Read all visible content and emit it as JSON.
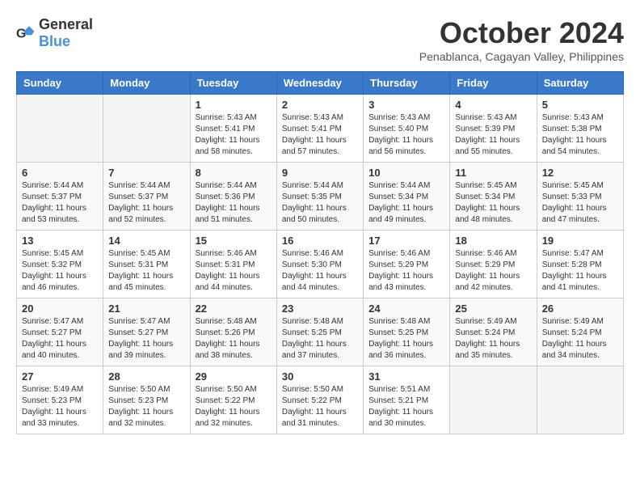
{
  "logo": {
    "general": "General",
    "blue": "Blue"
  },
  "title": "October 2024",
  "location": "Penablanca, Cagayan Valley, Philippines",
  "headers": [
    "Sunday",
    "Monday",
    "Tuesday",
    "Wednesday",
    "Thursday",
    "Friday",
    "Saturday"
  ],
  "weeks": [
    [
      {
        "day": "",
        "sunrise": "",
        "sunset": "",
        "daylight": ""
      },
      {
        "day": "",
        "sunrise": "",
        "sunset": "",
        "daylight": ""
      },
      {
        "day": "1",
        "sunrise": "Sunrise: 5:43 AM",
        "sunset": "Sunset: 5:41 PM",
        "daylight": "Daylight: 11 hours and 58 minutes."
      },
      {
        "day": "2",
        "sunrise": "Sunrise: 5:43 AM",
        "sunset": "Sunset: 5:41 PM",
        "daylight": "Daylight: 11 hours and 57 minutes."
      },
      {
        "day": "3",
        "sunrise": "Sunrise: 5:43 AM",
        "sunset": "Sunset: 5:40 PM",
        "daylight": "Daylight: 11 hours and 56 minutes."
      },
      {
        "day": "4",
        "sunrise": "Sunrise: 5:43 AM",
        "sunset": "Sunset: 5:39 PM",
        "daylight": "Daylight: 11 hours and 55 minutes."
      },
      {
        "day": "5",
        "sunrise": "Sunrise: 5:43 AM",
        "sunset": "Sunset: 5:38 PM",
        "daylight": "Daylight: 11 hours and 54 minutes."
      }
    ],
    [
      {
        "day": "6",
        "sunrise": "Sunrise: 5:44 AM",
        "sunset": "Sunset: 5:37 PM",
        "daylight": "Daylight: 11 hours and 53 minutes."
      },
      {
        "day": "7",
        "sunrise": "Sunrise: 5:44 AM",
        "sunset": "Sunset: 5:37 PM",
        "daylight": "Daylight: 11 hours and 52 minutes."
      },
      {
        "day": "8",
        "sunrise": "Sunrise: 5:44 AM",
        "sunset": "Sunset: 5:36 PM",
        "daylight": "Daylight: 11 hours and 51 minutes."
      },
      {
        "day": "9",
        "sunrise": "Sunrise: 5:44 AM",
        "sunset": "Sunset: 5:35 PM",
        "daylight": "Daylight: 11 hours and 50 minutes."
      },
      {
        "day": "10",
        "sunrise": "Sunrise: 5:44 AM",
        "sunset": "Sunset: 5:34 PM",
        "daylight": "Daylight: 11 hours and 49 minutes."
      },
      {
        "day": "11",
        "sunrise": "Sunrise: 5:45 AM",
        "sunset": "Sunset: 5:34 PM",
        "daylight": "Daylight: 11 hours and 48 minutes."
      },
      {
        "day": "12",
        "sunrise": "Sunrise: 5:45 AM",
        "sunset": "Sunset: 5:33 PM",
        "daylight": "Daylight: 11 hours and 47 minutes."
      }
    ],
    [
      {
        "day": "13",
        "sunrise": "Sunrise: 5:45 AM",
        "sunset": "Sunset: 5:32 PM",
        "daylight": "Daylight: 11 hours and 46 minutes."
      },
      {
        "day": "14",
        "sunrise": "Sunrise: 5:45 AM",
        "sunset": "Sunset: 5:31 PM",
        "daylight": "Daylight: 11 hours and 45 minutes."
      },
      {
        "day": "15",
        "sunrise": "Sunrise: 5:46 AM",
        "sunset": "Sunset: 5:31 PM",
        "daylight": "Daylight: 11 hours and 44 minutes."
      },
      {
        "day": "16",
        "sunrise": "Sunrise: 5:46 AM",
        "sunset": "Sunset: 5:30 PM",
        "daylight": "Daylight: 11 hours and 44 minutes."
      },
      {
        "day": "17",
        "sunrise": "Sunrise: 5:46 AM",
        "sunset": "Sunset: 5:29 PM",
        "daylight": "Daylight: 11 hours and 43 minutes."
      },
      {
        "day": "18",
        "sunrise": "Sunrise: 5:46 AM",
        "sunset": "Sunset: 5:29 PM",
        "daylight": "Daylight: 11 hours and 42 minutes."
      },
      {
        "day": "19",
        "sunrise": "Sunrise: 5:47 AM",
        "sunset": "Sunset: 5:28 PM",
        "daylight": "Daylight: 11 hours and 41 minutes."
      }
    ],
    [
      {
        "day": "20",
        "sunrise": "Sunrise: 5:47 AM",
        "sunset": "Sunset: 5:27 PM",
        "daylight": "Daylight: 11 hours and 40 minutes."
      },
      {
        "day": "21",
        "sunrise": "Sunrise: 5:47 AM",
        "sunset": "Sunset: 5:27 PM",
        "daylight": "Daylight: 11 hours and 39 minutes."
      },
      {
        "day": "22",
        "sunrise": "Sunrise: 5:48 AM",
        "sunset": "Sunset: 5:26 PM",
        "daylight": "Daylight: 11 hours and 38 minutes."
      },
      {
        "day": "23",
        "sunrise": "Sunrise: 5:48 AM",
        "sunset": "Sunset: 5:25 PM",
        "daylight": "Daylight: 11 hours and 37 minutes."
      },
      {
        "day": "24",
        "sunrise": "Sunrise: 5:48 AM",
        "sunset": "Sunset: 5:25 PM",
        "daylight": "Daylight: 11 hours and 36 minutes."
      },
      {
        "day": "25",
        "sunrise": "Sunrise: 5:49 AM",
        "sunset": "Sunset: 5:24 PM",
        "daylight": "Daylight: 11 hours and 35 minutes."
      },
      {
        "day": "26",
        "sunrise": "Sunrise: 5:49 AM",
        "sunset": "Sunset: 5:24 PM",
        "daylight": "Daylight: 11 hours and 34 minutes."
      }
    ],
    [
      {
        "day": "27",
        "sunrise": "Sunrise: 5:49 AM",
        "sunset": "Sunset: 5:23 PM",
        "daylight": "Daylight: 11 hours and 33 minutes."
      },
      {
        "day": "28",
        "sunrise": "Sunrise: 5:50 AM",
        "sunset": "Sunset: 5:23 PM",
        "daylight": "Daylight: 11 hours and 32 minutes."
      },
      {
        "day": "29",
        "sunrise": "Sunrise: 5:50 AM",
        "sunset": "Sunset: 5:22 PM",
        "daylight": "Daylight: 11 hours and 32 minutes."
      },
      {
        "day": "30",
        "sunrise": "Sunrise: 5:50 AM",
        "sunset": "Sunset: 5:22 PM",
        "daylight": "Daylight: 11 hours and 31 minutes."
      },
      {
        "day": "31",
        "sunrise": "Sunrise: 5:51 AM",
        "sunset": "Sunset: 5:21 PM",
        "daylight": "Daylight: 11 hours and 30 minutes."
      },
      {
        "day": "",
        "sunrise": "",
        "sunset": "",
        "daylight": ""
      },
      {
        "day": "",
        "sunrise": "",
        "sunset": "",
        "daylight": ""
      }
    ]
  ]
}
